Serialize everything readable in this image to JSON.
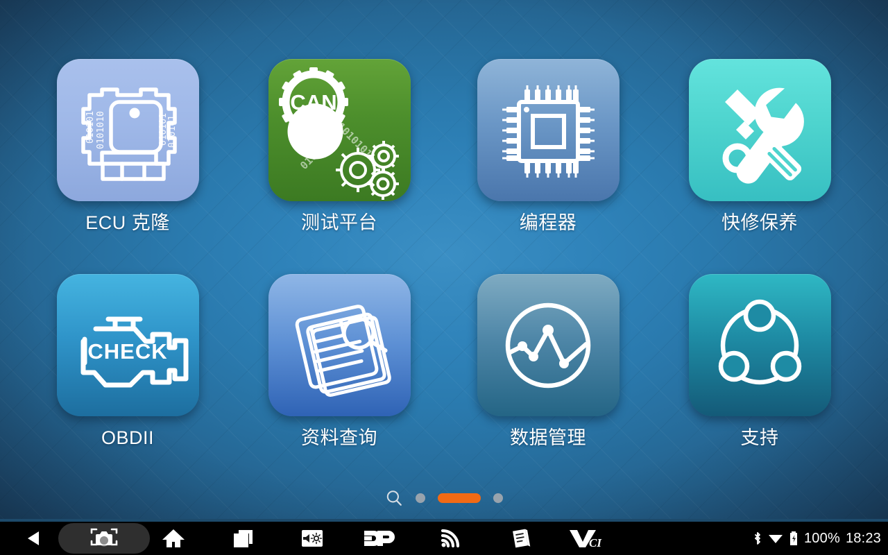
{
  "wallpaper": {
    "center_color": "#2f83ba",
    "edge_color": "#1a3650"
  },
  "home": {
    "apps": [
      {
        "id": "ecu-clone",
        "label": "ECU 克隆",
        "icon": "ecu-module-icon",
        "tile_class": "g-ecu",
        "accent": "#9fb8e8"
      },
      {
        "id": "test-bench",
        "label": "测试平台",
        "icon": "can-gear-icon",
        "tile_class": "g-can",
        "accent": "#4d8f2c"
      },
      {
        "id": "programmer",
        "label": "编程器",
        "icon": "cpu-chip-icon",
        "tile_class": "g-prog",
        "accent": "#6b97c6"
      },
      {
        "id": "quick-service",
        "label": "快修保养",
        "icon": "wrench-screwdriver-icon",
        "tile_class": "g-main",
        "accent": "#4ed4ce"
      },
      {
        "id": "obdii",
        "label": "OBDII",
        "icon": "check-engine-icon",
        "tile_class": "g-obd",
        "accent": "#2f94c9"
      },
      {
        "id": "data-lookup",
        "label": "资料查询",
        "icon": "document-search-icon",
        "tile_class": "g-doc",
        "accent": "#5c8fd4"
      },
      {
        "id": "data-manage",
        "label": "数据管理",
        "icon": "data-graph-icon",
        "tile_class": "g-data",
        "accent": "#4f87a8"
      },
      {
        "id": "support",
        "label": "支持",
        "icon": "share-network-icon",
        "tile_class": "g-supp",
        "accent": "#1e8ba4"
      }
    ],
    "ecu_tile_binary": "010101",
    "can_tile_text": "CAN",
    "can_tile_binary": "010101010101",
    "obd_tile_text": "CHECK"
  },
  "pager": {
    "search_icon": "search-icon",
    "pages": 3,
    "active_page": 2,
    "active_color": "#f26a14",
    "inactive_color": "#98a3ad"
  },
  "navbar": {
    "buttons": [
      {
        "id": "back",
        "icon": "back-triangle-icon"
      },
      {
        "id": "screenshot",
        "icon": "screenshot-camera-icon"
      },
      {
        "id": "home",
        "icon": "home-icon"
      },
      {
        "id": "recents",
        "icon": "recents-square-icon"
      },
      {
        "id": "volume",
        "icon": "volume-brightness-icon"
      },
      {
        "id": "dp",
        "icon": "dp-logo-icon"
      },
      {
        "id": "wireless",
        "icon": "wifi-signal-icon"
      },
      {
        "id": "manual",
        "icon": "manual-book-icon"
      },
      {
        "id": "vci",
        "icon": "vci-logo-icon"
      }
    ],
    "dp_label": "DP",
    "vci_label": "VCI"
  },
  "status": {
    "bluetooth_icon": "bluetooth-icon",
    "wifi_icon": "wifi-icon",
    "battery_icon": "battery-charging-icon",
    "battery_percent": "100%",
    "clock": "18:23"
  }
}
